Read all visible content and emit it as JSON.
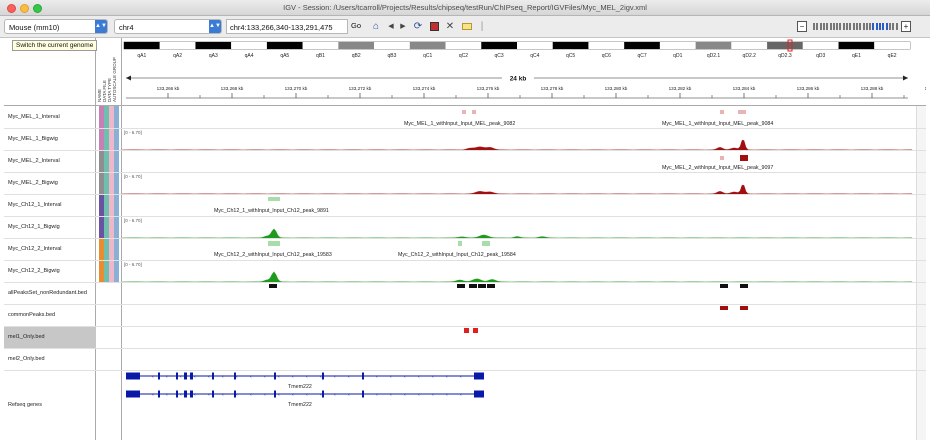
{
  "window": {
    "title": "IGV - Session: /Users/tcarroll/Projects/Results/chipseq/testRun/ChIPseq_Report/IGVFiles/Myc_MEL_2igv.xml"
  },
  "toolbar": {
    "genome": "Mouse (mm10)",
    "chromosome": "chr4",
    "locus": "chr4:133,266,340-133,291,475",
    "go_label": "Go",
    "icons": [
      "home-icon",
      "back-icon",
      "forward-icon",
      "refresh-icon",
      "roi-icon",
      "close-icon",
      "popup-icon"
    ]
  },
  "tooltip": {
    "text": "Switch the current genome"
  },
  "attribute_header": [
    "NAME",
    "DATA FILE",
    "DATA TYPE",
    "AUTOSCALE GROUP"
  ],
  "ideogram": {
    "bands": [
      "qA1",
      "qA2",
      "qA3",
      "qA4",
      "qA5",
      "qB1",
      "qB2",
      "qB3",
      "qC1",
      "qC2",
      "qC3",
      "qC4",
      "qC5",
      "qC6",
      "qC7",
      "qD1",
      "qD2.1",
      "qD2.2",
      "qD2.3",
      "qD3",
      "qE1",
      "qE2"
    ]
  },
  "ruler": {
    "span_label": "24 kb",
    "ticks": [
      "133,266 kb",
      "133,268 kb",
      "133,270 kb",
      "133,272 kb",
      "133,274 kb",
      "133,276 kb",
      "133,278 kb",
      "133,280 kb",
      "133,282 kb",
      "133,284 kb",
      "133,286 kb",
      "133,288 kb",
      "133,290 kb"
    ]
  },
  "tracks": [
    {
      "name": "Myc_MEL_1_Interval",
      "attr_colors": [
        "#c77fb5",
        "#6fbfb0",
        "#f0b7c8",
        "#8bb0d6"
      ]
    },
    {
      "name": "Myc_MEL_1_Bigwig",
      "scale": "[0 - 6.70]",
      "attr_colors": [
        "#c77fb5",
        "#6fbfb0",
        "#f0b7c8",
        "#8bb0d6"
      ]
    },
    {
      "name": "Myc_MEL_2_Interval",
      "attr_colors": [
        "#8e8e8e",
        "#6fbfb0",
        "#f0b7c8",
        "#8bb0d6"
      ]
    },
    {
      "name": "Myc_MEL_2_Bigwig",
      "scale": "[0 - 6.70]",
      "attr_colors": [
        "#8e8e8e",
        "#6fbfb0",
        "#f0b7c8",
        "#8bb0d6"
      ]
    },
    {
      "name": "Myc_Ch12_1_Interval",
      "attr_colors": [
        "#6a52a3",
        "#6fbfb0",
        "#f0b7c8",
        "#8bb0d6"
      ]
    },
    {
      "name": "Myc_Ch12_1_Bigwig",
      "scale": "[0 - 6.70]",
      "attr_colors": [
        "#6a52a3",
        "#6fbfb0",
        "#f0b7c8",
        "#8bb0d6"
      ]
    },
    {
      "name": "Myc_Ch12_2_Interval",
      "attr_colors": [
        "#e88c30",
        "#6fbfb0",
        "#f0b7c8",
        "#8bb0d6"
      ]
    },
    {
      "name": "Myc_Ch12_2_Bigwig",
      "scale": "[0 - 6.70]",
      "attr_colors": [
        "#e88c30",
        "#6fbfb0",
        "#f0b7c8",
        "#8bb0d6"
      ]
    },
    {
      "name": "allPeaksSet_nonRedundant.bed",
      "attr_colors": []
    },
    {
      "name": "commonPeaks.bed",
      "attr_colors": []
    },
    {
      "name": "mel1_Only.bed",
      "attr_colors": [],
      "selected": true
    },
    {
      "name": "mel2_Only.bed",
      "attr_colors": []
    },
    {
      "name": "Refseq genes",
      "attr_colors": []
    }
  ],
  "feature_labels": {
    "mel1_peak_a": "Myc_MEL_1_withInput_Input_MEL_peak_9082",
    "mel1_peak_b": "Myc_MEL_1_withInput_Input_MEL_peak_9084",
    "mel2_peak": "Myc_MEL_2_withInput_Input_MEL_peak_9097",
    "ch12_1_peak": "Myc_Ch12_1_withInput_Input_Ch12_peak_9891",
    "ch12_2_peak_a": "Myc_Ch12_2_withInput_Input_Ch12_peak_19583",
    "ch12_2_peak_b": "Myc_Ch12_2_withInput_Input_Ch12_peak_19584",
    "gene_1": "Tmem222",
    "gene_2": "Tmem222"
  },
  "colors": {
    "mel_signal": "#a01010",
    "mel_interval": "#e8b3b3",
    "ch12_signal": "#1e9a1e",
    "ch12_interval": "#a8dca8",
    "gene": "#0a1aa8",
    "bed_black": "#111111",
    "common": "#a01010",
    "mel1_only": "#e02020"
  }
}
